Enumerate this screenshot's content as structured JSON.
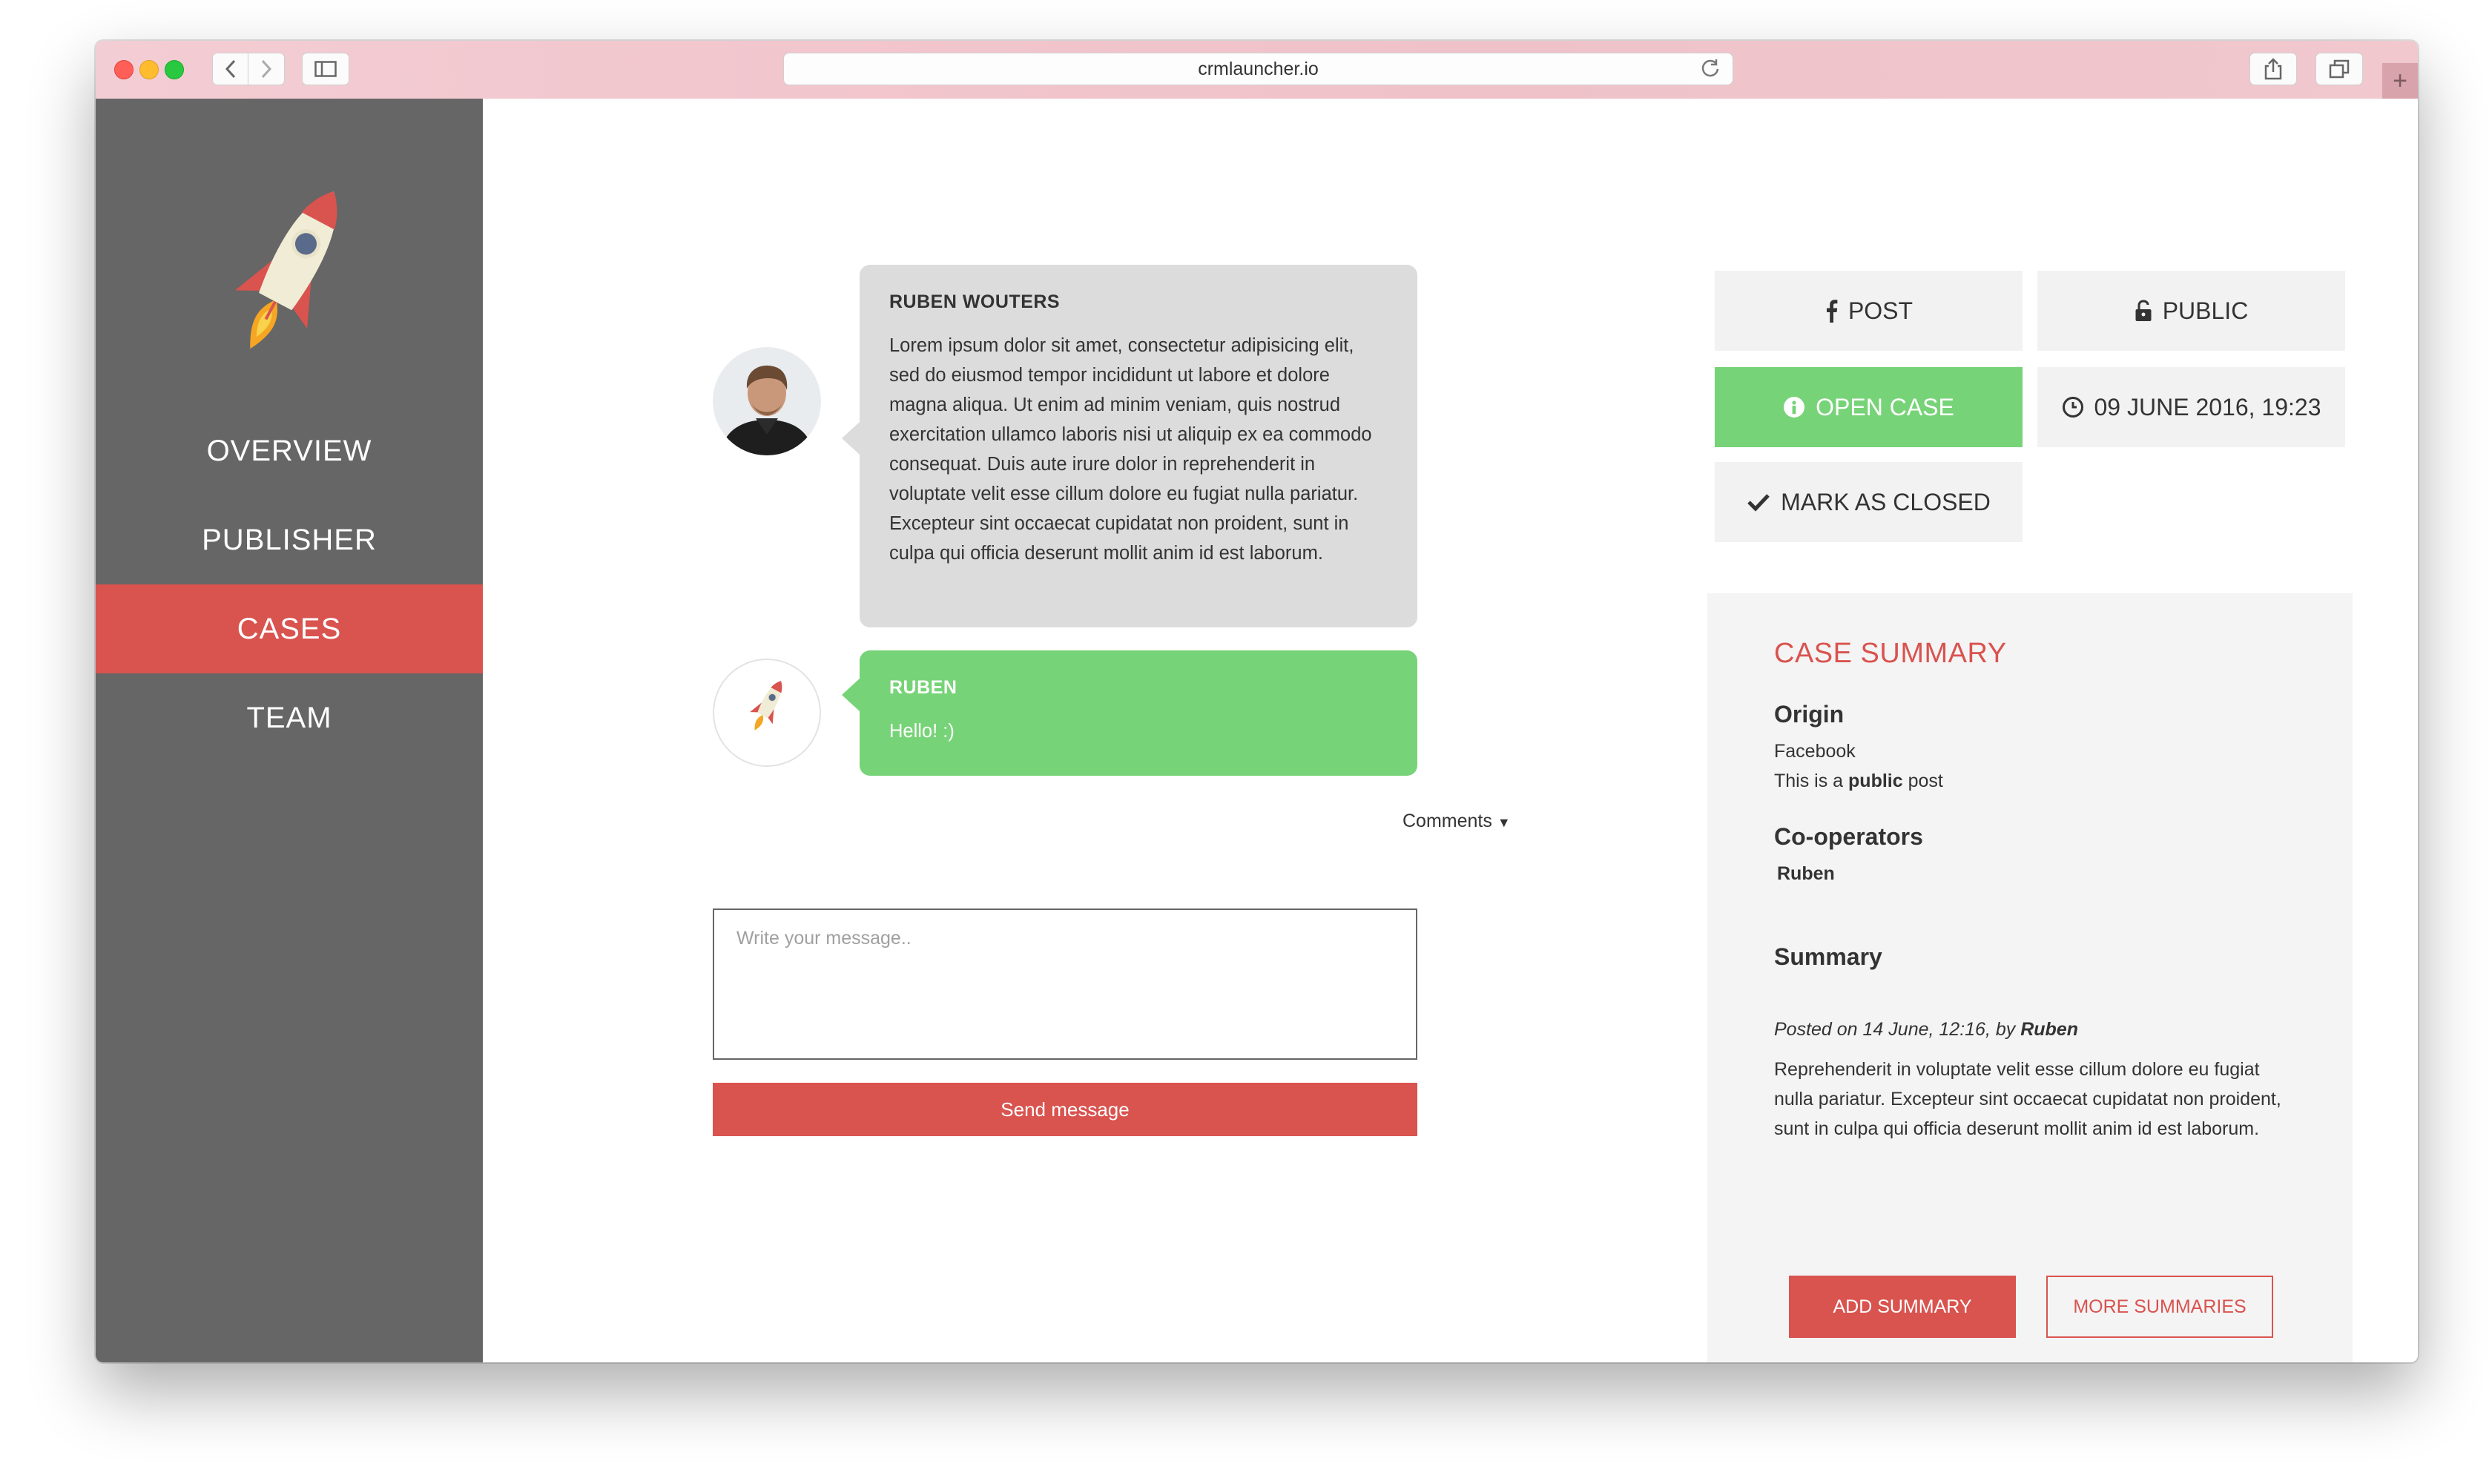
{
  "browser": {
    "url": "crmlauncher.io"
  },
  "sidebar": {
    "items": [
      {
        "label": "OVERVIEW"
      },
      {
        "label": "PUBLISHER"
      },
      {
        "label": "CASES"
      },
      {
        "label": "TEAM"
      }
    ],
    "active": "CASES"
  },
  "conversation": {
    "messages": [
      {
        "author": "RUBEN WOUTERS",
        "text": "Lorem ipsum dolor sit amet, consectetur adipisicing elit, sed do eiusmod tempor incididunt ut labore et dolore magna aliqua. Ut enim ad minim veniam, quis nostrud exercitation ullamco laboris nisi ut aliquip ex ea commodo consequat. Duis aute irure dolor in reprehenderit in voluptate velit esse cillum dolore eu fugiat nulla pariatur. Excepteur sint occaecat cupidatat non proident, sunt in culpa qui officia deserunt mollit anim id est laborum."
      },
      {
        "author": "RUBEN",
        "text": "Hello! :)"
      }
    ],
    "comments_label": "Comments",
    "input_placeholder": "Write your message..",
    "send_label": "Send message"
  },
  "actions": {
    "post": "POST",
    "public": "PUBLIC",
    "open_case": "OPEN CASE",
    "date": "09 JUNE 2016, 19:23",
    "mark_closed": "MARK AS CLOSED"
  },
  "case_summary": {
    "title": "CASE SUMMARY",
    "origin_heading": "Origin",
    "origin_value": "Facebook",
    "origin_note_prefix": "This is a ",
    "origin_note_bold": "public",
    "origin_note_suffix": " post",
    "cooperators_heading": "Co-operators",
    "cooperator": "Ruben",
    "summary_heading": "Summary",
    "posted_prefix": "Posted on 14 June, 12:16, by ",
    "posted_by": "Ruben",
    "summary_text": "Reprehenderit in voluptate velit esse cillum dolore eu fugiat nulla pariatur. Excepteur sint occaecat cupidatat non proident, sunt in culpa qui officia deserunt mollit anim id est laborum.",
    "add_label": "ADD SUMMARY",
    "more_label": "MORE SUMMARIES"
  },
  "colors": {
    "accent": "#d9534f",
    "success": "#77d377",
    "sidebar": "#666666"
  },
  "icons": [
    "facebook-icon",
    "unlock-icon",
    "info-icon",
    "clock-icon",
    "check-icon",
    "rocket-icon",
    "caret-down-icon"
  ]
}
